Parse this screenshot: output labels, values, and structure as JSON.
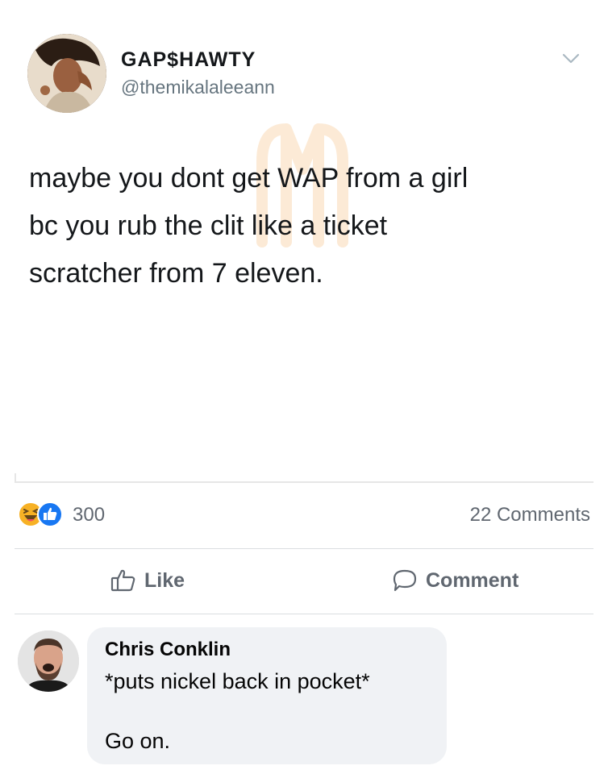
{
  "tweet": {
    "display_name": "GAP$HAWTY",
    "handle": "@themikalaleeann",
    "text_lines": [
      "maybe you dont get WAP from a girl",
      "bc you rub the clit like a ticket",
      "scratcher from 7 eleven."
    ],
    "menu_icon": "chevron-down-icon",
    "avatar_icon": "profile-photo"
  },
  "post": {
    "reaction_icons": [
      "haha-icon",
      "like-icon"
    ],
    "reaction_count": "300",
    "comment_count": "22 Comments",
    "actions": {
      "like_label": "Like",
      "comment_label": "Comment"
    }
  },
  "comment": {
    "author": "Chris Conklin",
    "lines": [
      "*puts nickel back in pocket*",
      "Go on."
    ]
  },
  "colors": {
    "fb_blue": "#1877f2",
    "haha_yellow": "#f7b125",
    "text_secondary": "#606770",
    "bubble_bg": "#f0f2f5"
  }
}
